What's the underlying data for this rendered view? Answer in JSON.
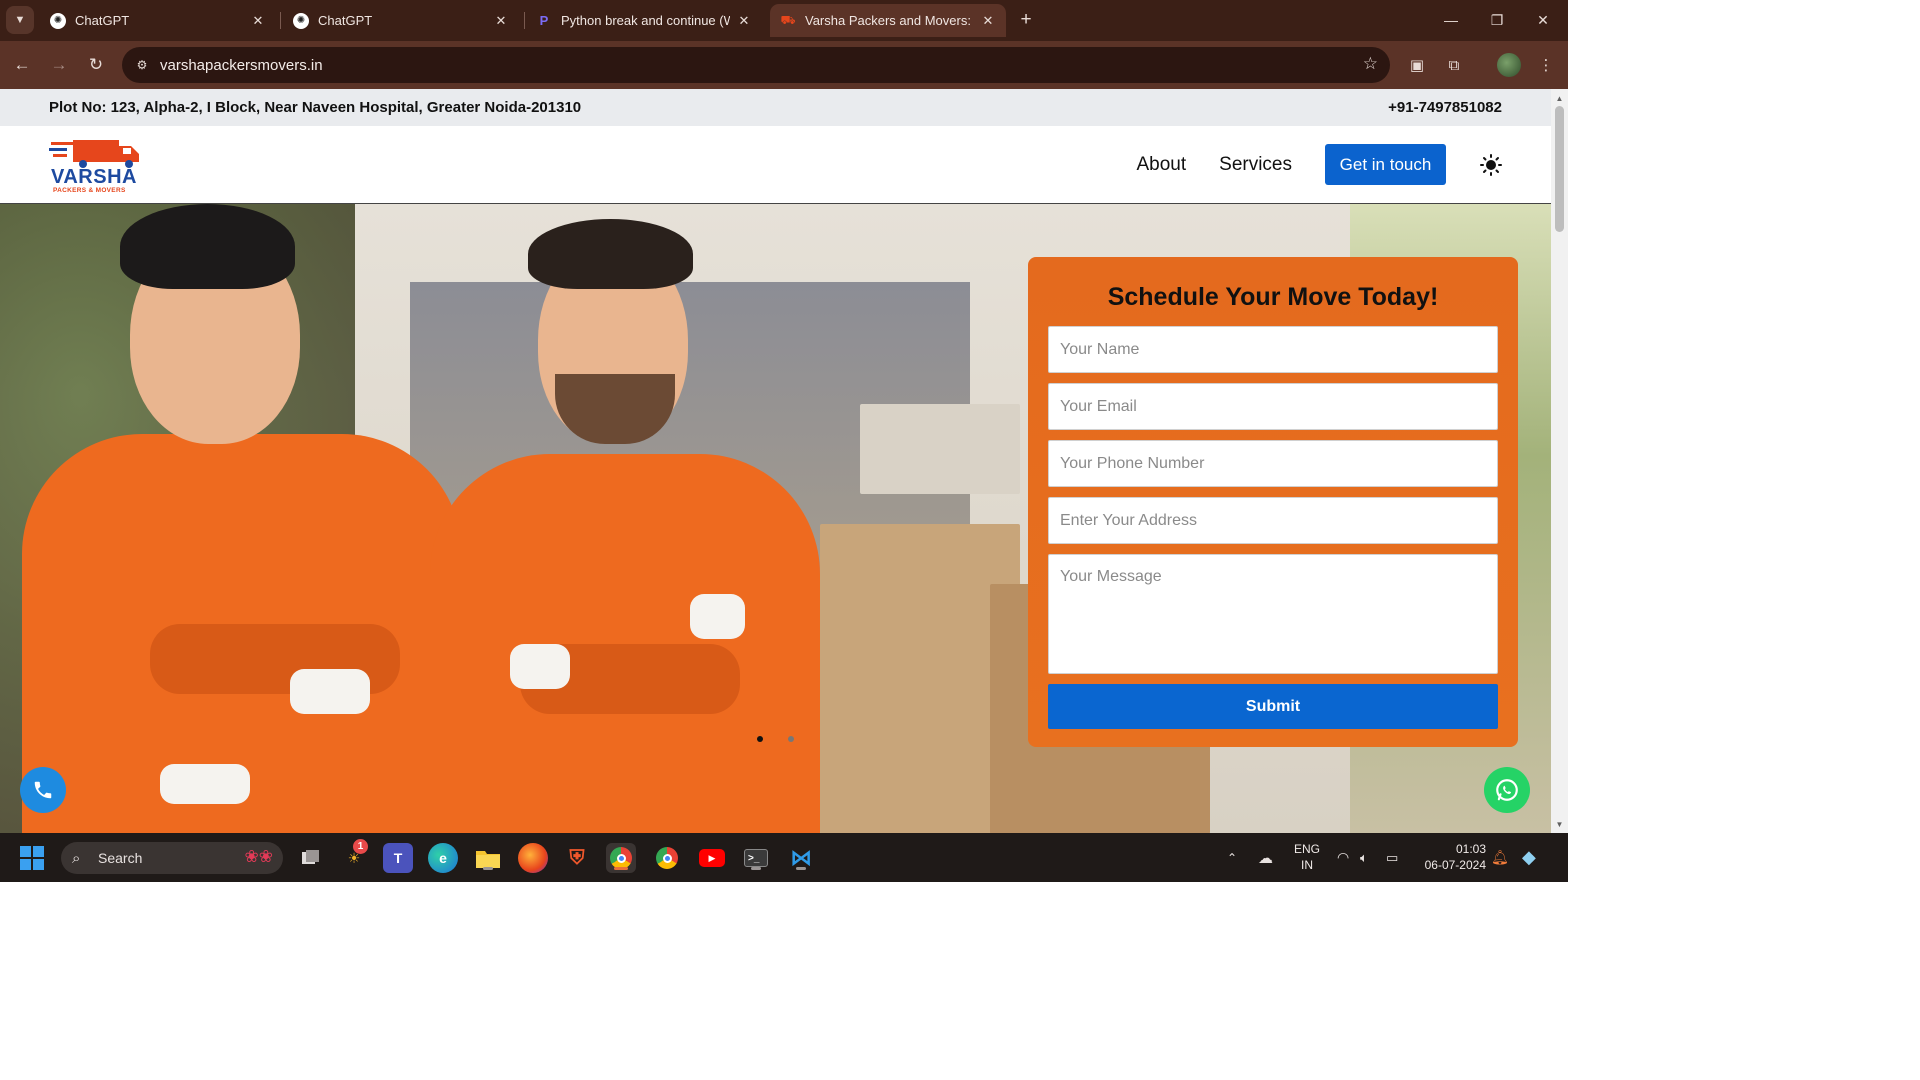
{
  "browser": {
    "tabs": [
      {
        "title": "ChatGPT",
        "favicon": "chatgpt-icon",
        "active": false
      },
      {
        "title": "ChatGPT",
        "favicon": "chatgpt-icon",
        "active": false
      },
      {
        "title": "Python break and continue (Wit",
        "favicon": "programiz-icon",
        "active": false
      },
      {
        "title": "Varsha Packers and Movers: Tru",
        "favicon": "truck-icon",
        "active": true
      }
    ],
    "url": "varshapackersmovers.in"
  },
  "site": {
    "address": "Plot No: 123, Alpha-2, I Block, Near Naveen Hospital, Greater Noida-201310",
    "phone": "+91-7497851082",
    "logo_brand": "VARSHA",
    "logo_tagline": "PACKERS & MOVERS",
    "nav": {
      "about": "About",
      "services": "Services",
      "cta": "Get in touch"
    },
    "form": {
      "title": "Schedule Your Move Today!",
      "name_placeholder": "Your Name",
      "email_placeholder": "Your Email",
      "phone_placeholder": "Your Phone Number",
      "address_placeholder": "Enter Your Address",
      "message_placeholder": "Your Message",
      "submit": "Submit"
    },
    "carousel": {
      "slides": 2,
      "active_slide": 1
    },
    "colors": {
      "brand_blue": "#0b63ce",
      "brand_orange": "#e46a1e",
      "whatsapp_green": "#25d366",
      "call_blue": "#1e8be0"
    }
  },
  "taskbar": {
    "search": "Search",
    "language": "ENG",
    "region": "IN",
    "time": "01:03",
    "date": "06-07-2024",
    "notification_badge": "1"
  }
}
